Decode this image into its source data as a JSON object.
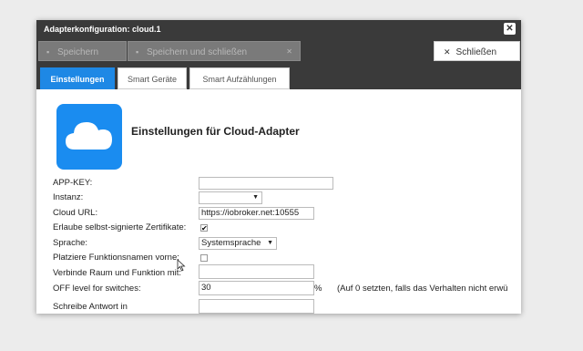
{
  "window": {
    "title": "Adapterkonfiguration: cloud.1"
  },
  "toolbar": {
    "save_label": "Speichern",
    "save_close_label": "Speichern und schließen",
    "close_label": "Schließen"
  },
  "tabs": [
    {
      "label": "Einstellungen",
      "active": true
    },
    {
      "label": "Smart Geräte",
      "active": false
    },
    {
      "label": "Smart Aufzählungen",
      "active": false
    }
  ],
  "page": {
    "heading": "Einstellungen für Cloud-Adapter"
  },
  "form": {
    "app_key": {
      "label": "APP-KEY:",
      "value": ""
    },
    "instance": {
      "label": "Instanz:",
      "value": ""
    },
    "cloud_url": {
      "label": "Cloud URL:",
      "value": "https://iobroker.net:10555"
    },
    "self_signed": {
      "label": "Erlaube selbst-signierte Zertifikate:",
      "checked": true,
      "mark": "✔"
    },
    "language": {
      "label": "Sprache:",
      "value": "Systemsprache"
    },
    "function_first": {
      "label": "Platziere Funktionsnamen vorne:",
      "checked": false
    },
    "concat_word": {
      "label": "Verbinde Raum und Funktion mit:",
      "value": ""
    },
    "off_level": {
      "label": "OFF level for switches:",
      "value": "30",
      "unit": "%",
      "note": "(Auf 0 setzten, falls das Verhalten nicht erwü"
    },
    "partial_row_label": "Schreibe Antwort in"
  },
  "colors": {
    "accent": "#1e88e5",
    "titlebar": "#3a3a3a",
    "logo_bg": "#1a8cf0"
  },
  "icons": [
    "save-icon",
    "close-icon",
    "cloud-icon",
    "chevron-down-icon",
    "checkmark-icon",
    "mouse-cursor-icon"
  ]
}
